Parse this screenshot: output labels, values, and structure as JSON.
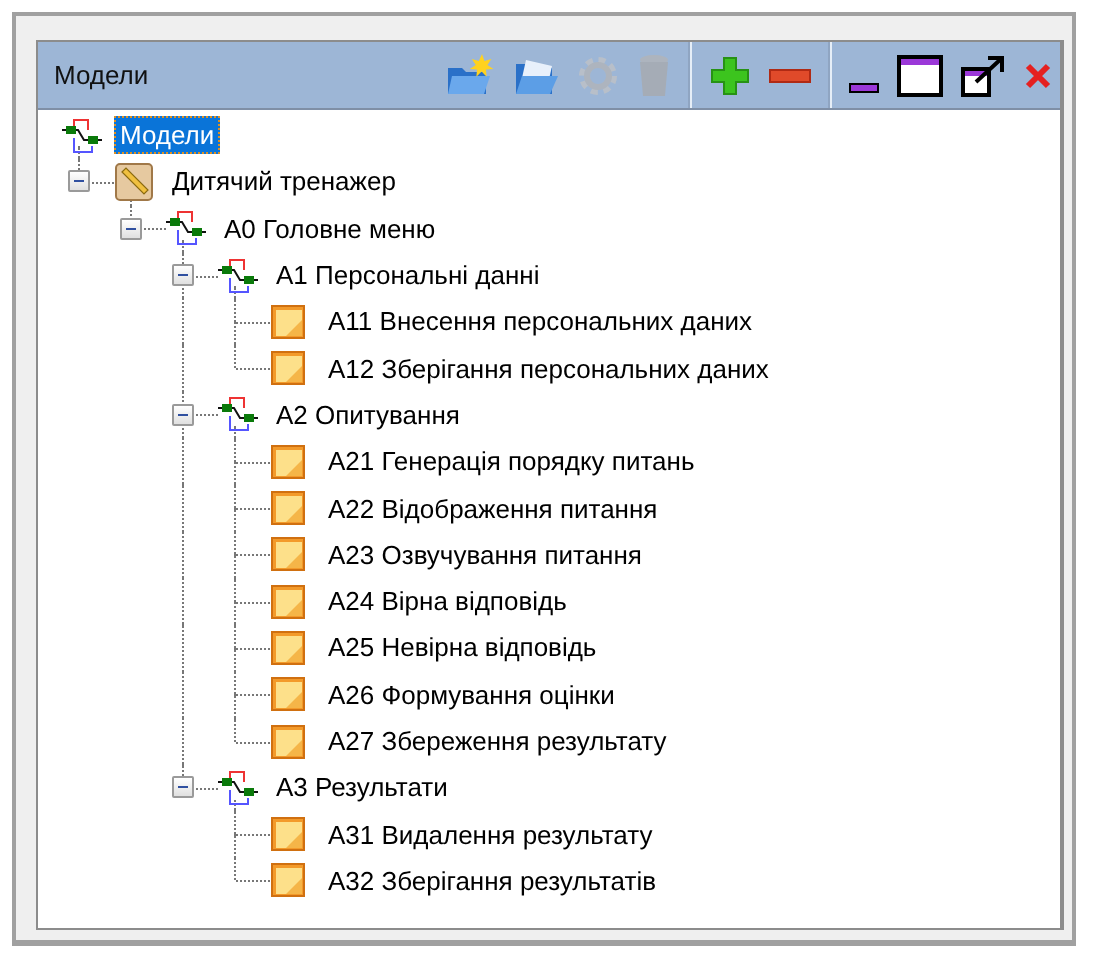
{
  "panel": {
    "title": "Модели"
  },
  "toolbar_groups": [
    [
      {
        "kind": "new-folder",
        "disabled": false
      },
      {
        "kind": "open-folder",
        "disabled": false
      },
      {
        "kind": "gear",
        "disabled": true
      },
      {
        "kind": "trash",
        "disabled": true
      }
    ],
    [
      {
        "kind": "plus",
        "disabled": false
      },
      {
        "kind": "minus",
        "disabled": false
      }
    ],
    [
      {
        "kind": "minimize",
        "disabled": false
      },
      {
        "kind": "maximize",
        "disabled": false
      },
      {
        "kind": "restore",
        "disabled": false
      },
      {
        "kind": "close",
        "disabled": false
      }
    ]
  ],
  "tree": [
    {
      "label": "Модели",
      "kind": "model",
      "selected": true,
      "children": [
        {
          "label": "Дитячий тренажер",
          "kind": "project",
          "selected": false,
          "expanded": true,
          "children": [
            {
              "label": "A0 Головне меню",
              "kind": "diagram",
              "selected": false,
              "expanded": true,
              "children": [
                {
                  "label": "A1 Персональні данні",
                  "kind": "diagram",
                  "selected": false,
                  "expanded": true,
                  "children": [
                    {
                      "label": "A11 Внесення персональних даних",
                      "kind": "activity",
                      "selected": false
                    },
                    {
                      "label": "A12 Зберігання персональних даних",
                      "kind": "activity",
                      "selected": false
                    }
                  ]
                },
                {
                  "label": "A2 Опитування",
                  "kind": "diagram",
                  "selected": false,
                  "expanded": true,
                  "children": [
                    {
                      "label": "A21 Генерація порядку питань",
                      "kind": "activity",
                      "selected": false
                    },
                    {
                      "label": "A22 Відображення питання",
                      "kind": "activity",
                      "selected": false
                    },
                    {
                      "label": "A23 Озвучування питання",
                      "kind": "activity",
                      "selected": false
                    },
                    {
                      "label": "A24 Вірна відповідь",
                      "kind": "activity",
                      "selected": false
                    },
                    {
                      "label": "A25 Невірна відповідь",
                      "kind": "activity",
                      "selected": false
                    },
                    {
                      "label": "A26 Формування оцінки",
                      "kind": "activity",
                      "selected": false
                    },
                    {
                      "label": "A27 Збереження результату",
                      "kind": "activity",
                      "selected": false
                    }
                  ]
                },
                {
                  "label": "A3 Результати",
                  "kind": "diagram",
                  "selected": false,
                  "expanded": true,
                  "children": [
                    {
                      "label": "A31 Видалення результату",
                      "kind": "activity",
                      "selected": false
                    },
                    {
                      "label": "A32 Зберігання результатів",
                      "kind": "activity",
                      "selected": false
                    }
                  ]
                }
              ]
            }
          ]
        }
      ]
    }
  ]
}
